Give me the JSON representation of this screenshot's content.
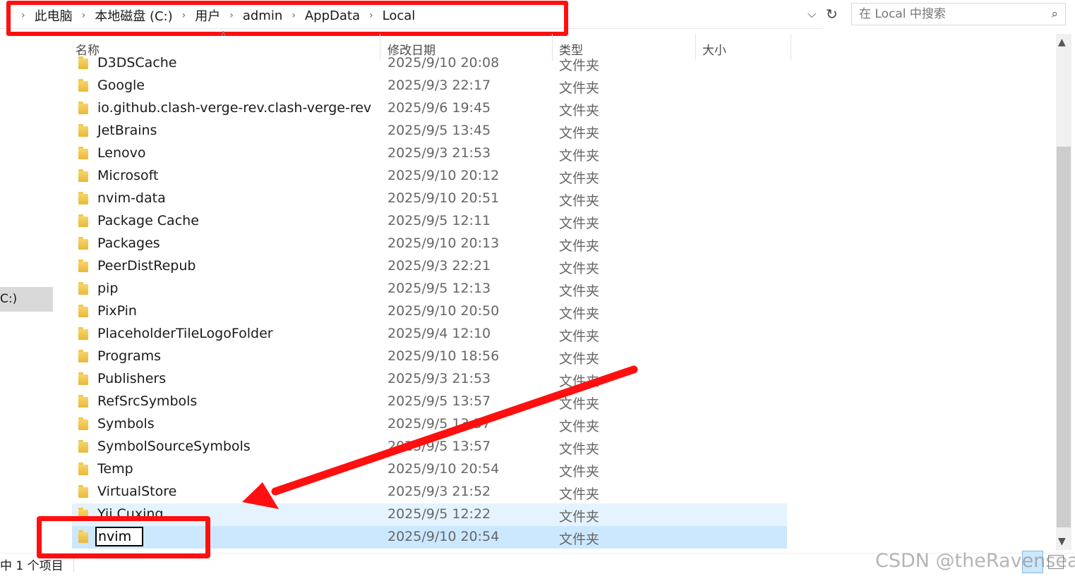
{
  "breadcrumb": {
    "items": [
      "此电脑",
      "本地磁盘 (C:)",
      "用户",
      "admin",
      "AppData",
      "Local"
    ]
  },
  "search": {
    "placeholder": "在 Local 中搜索"
  },
  "nav": {
    "selected_label": "C:)"
  },
  "columns": {
    "name": "名称",
    "date": "修改日期",
    "type": "类型",
    "size": "大小"
  },
  "files": [
    {
      "name": "D3DSCache",
      "date": "2025/9/10 20:08",
      "type": "文件夹"
    },
    {
      "name": "Google",
      "date": "2025/9/3 22:17",
      "type": "文件夹"
    },
    {
      "name": "io.github.clash-verge-rev.clash-verge-rev",
      "date": "2025/9/6 19:45",
      "type": "文件夹"
    },
    {
      "name": "JetBrains",
      "date": "2025/9/5 13:45",
      "type": "文件夹"
    },
    {
      "name": "Lenovo",
      "date": "2025/9/3 21:53",
      "type": "文件夹"
    },
    {
      "name": "Microsoft",
      "date": "2025/9/10 20:12",
      "type": "文件夹"
    },
    {
      "name": "nvim-data",
      "date": "2025/9/10 20:51",
      "type": "文件夹"
    },
    {
      "name": "Package Cache",
      "date": "2025/9/5 12:11",
      "type": "文件夹"
    },
    {
      "name": "Packages",
      "date": "2025/9/10 20:13",
      "type": "文件夹"
    },
    {
      "name": "PeerDistRepub",
      "date": "2025/9/3 22:21",
      "type": "文件夹"
    },
    {
      "name": "pip",
      "date": "2025/9/5 12:13",
      "type": "文件夹"
    },
    {
      "name": "PixPin",
      "date": "2025/9/10 20:50",
      "type": "文件夹"
    },
    {
      "name": "PlaceholderTileLogoFolder",
      "date": "2025/9/4 12:10",
      "type": "文件夹"
    },
    {
      "name": "Programs",
      "date": "2025/9/10 18:56",
      "type": "文件夹"
    },
    {
      "name": "Publishers",
      "date": "2025/9/3 21:53",
      "type": "文件夹"
    },
    {
      "name": "RefSrcSymbols",
      "date": "2025/9/5 13:57",
      "type": "文件夹"
    },
    {
      "name": "Symbols",
      "date": "2025/9/5 13:57",
      "type": "文件夹"
    },
    {
      "name": "SymbolSourceSymbols",
      "date": "2025/9/5 13:57",
      "type": "文件夹"
    },
    {
      "name": "Temp",
      "date": "2025/9/10 20:54",
      "type": "文件夹"
    },
    {
      "name": "VirtualStore",
      "date": "2025/9/3 21:52",
      "type": "文件夹"
    },
    {
      "name": "Yii Cuxing",
      "date": "2025/9/5 12:22",
      "type": "文件夹"
    }
  ],
  "renaming": {
    "value": "nvim",
    "date": "2025/9/10 20:54",
    "type": "文件夹"
  },
  "status": {
    "text": "中 1 个项目"
  },
  "watermark": "CSDN @theRavensea",
  "colors": {
    "annotation": "#ff0f0f",
    "selection": "#cce8ff",
    "hover": "#e5f3ff"
  }
}
